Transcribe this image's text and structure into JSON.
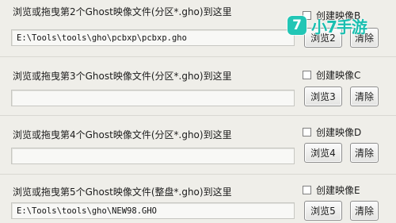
{
  "rows": [
    {
      "label": "浏览或拖曳第2个Ghost映像文件(分区*.gho)到这里",
      "path_value": "E:\\Tools\\tools\\gho\\pcbxp\\pcbxp.gho",
      "checkbox_label": "创建映像B",
      "checked": false,
      "browse_label": "浏览2",
      "clear_label": "清除"
    },
    {
      "label": "浏览或拖曳第3个Ghost映像文件(分区*.gho)到这里",
      "path_value": "",
      "checkbox_label": "创建映像C",
      "checked": false,
      "browse_label": "浏览3",
      "clear_label": "清除"
    },
    {
      "label": "浏览或拖曳第4个Ghost映像文件(分区*.gho)到这里",
      "path_value": "",
      "checkbox_label": "创建映像D",
      "checked": false,
      "browse_label": "浏览4",
      "clear_label": "清除"
    },
    {
      "label": "浏览或拖曳第5个Ghost映像文件(整盘*.gho)到这里",
      "path_value": "E:\\Tools\\tools\\gho\\NEW98.GHO",
      "checkbox_label": "创建映像E",
      "checked": false,
      "browse_label": "浏览5",
      "clear_label": "清除"
    }
  ],
  "watermark": {
    "badge": "7",
    "text": "小7手游"
  },
  "colors": {
    "background": "#efeee9",
    "watermark": "#22c6b5"
  }
}
